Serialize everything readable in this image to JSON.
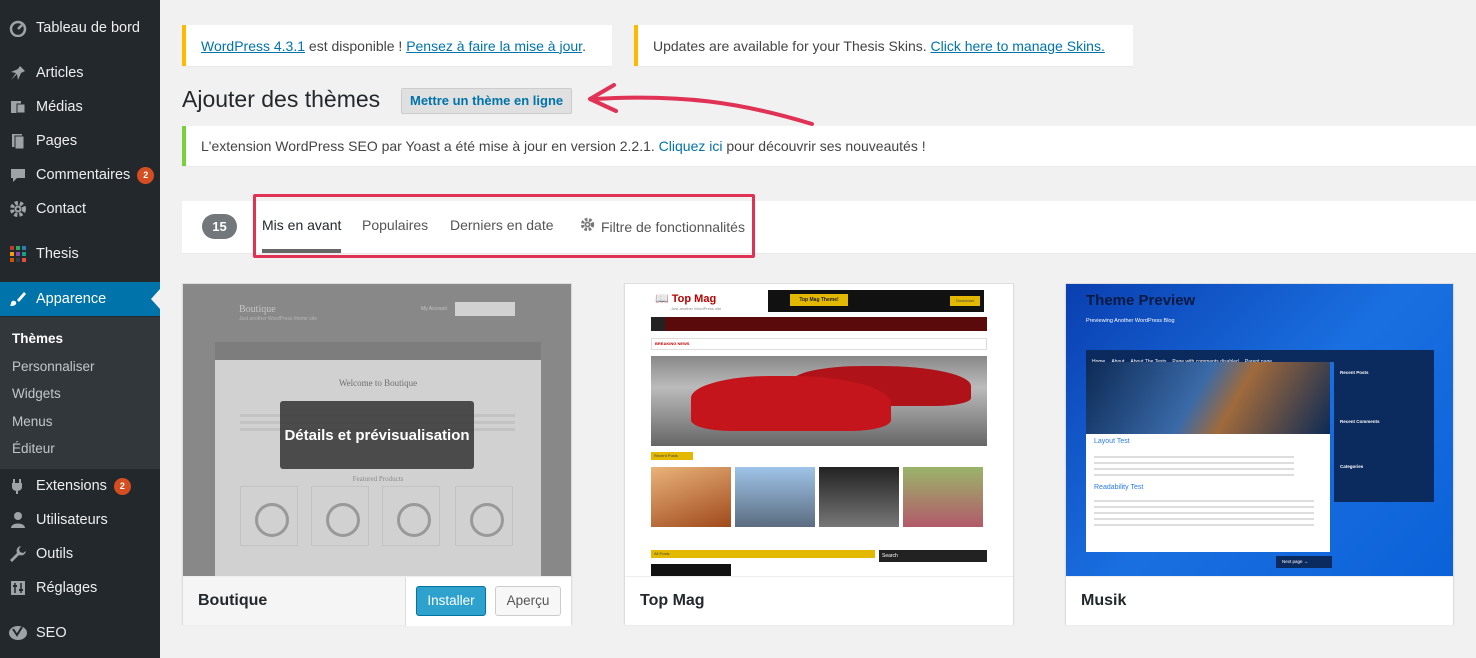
{
  "sidebar": {
    "items": [
      {
        "label": "Tableau de bord",
        "icon": "dashboard-icon"
      },
      {
        "label": "Articles",
        "icon": "pin-icon"
      },
      {
        "label": "Médias",
        "icon": "media-icon"
      },
      {
        "label": "Pages",
        "icon": "pages-icon"
      },
      {
        "label": "Commentaires",
        "icon": "comments-icon",
        "badge": "2"
      },
      {
        "label": "Contact",
        "icon": "gear-icon"
      },
      {
        "label": "Thesis",
        "icon": "grid-icon"
      },
      {
        "label": "Apparence",
        "icon": "brush-icon"
      },
      {
        "label": "Extensions",
        "icon": "plugin-icon",
        "badge": "2"
      },
      {
        "label": "Utilisateurs",
        "icon": "user-icon"
      },
      {
        "label": "Outils",
        "icon": "wrench-icon"
      },
      {
        "label": "Réglages",
        "icon": "settings-icon"
      },
      {
        "label": "SEO",
        "icon": "yoast-icon"
      }
    ],
    "submenu": [
      "Thèmes",
      "Personnaliser",
      "Widgets",
      "Menus",
      "Éditeur"
    ]
  },
  "notices": {
    "wp_link": "WordPress 4.3.1",
    "wp_text": " est disponible ! ",
    "wp_update_link": "Pensez à faire la mise à jour",
    "wp_end": ".",
    "thesis_text": "Updates are available for your Thesis Skins. ",
    "thesis_link": "Click here to manage Skins.",
    "yoast_text": "L'extension WordPress SEO par Yoast a été mise à jour en version 2.2.1. ",
    "yoast_link": "Cliquez ici",
    "yoast_end": " pour découvrir ses nouveautés !"
  },
  "page": {
    "title": "Ajouter des thèmes",
    "upload_button": "Mettre un thème en ligne"
  },
  "filter": {
    "count": "15",
    "tabs": [
      "Mis en avant",
      "Populaires",
      "Derniers en date",
      "Filtre de fonctionnalités"
    ]
  },
  "themes": [
    {
      "name": "Boutique",
      "details_label": "Détails et prévisualisation",
      "install_label": "Installer",
      "preview_label": "Aperçu",
      "shot": {
        "title": "Boutique",
        "subtitle": "Just another WordPress theme site",
        "account": "My Account",
        "welcome": "Welcome to Boutique",
        "featured": "Featured Products"
      }
    },
    {
      "name": "Top Mag",
      "shot": {
        "logo_top": "Top",
        "logo_mag": " Mag",
        "tagline": "Just another WordPress site",
        "ad_button": "Top Mag Theme!",
        "download": "Download",
        "breaking": "BREAKING NEWS",
        "recent": "Recent Posts",
        "all_posts": "All Posts",
        "search": "Search"
      }
    },
    {
      "name": "Musik",
      "shot": {
        "title": "Theme Preview",
        "subtitle": "Previewing Another WordPress Blog",
        "nav": [
          "Home",
          "About",
          "About The Tests",
          "Page with comments disabled",
          "Parent page"
        ],
        "layout_test": "Layout Test",
        "readability": "Readability Test",
        "side": [
          "Recent Posts",
          "Recent Comments",
          "Categories"
        ],
        "next": "Next page →"
      }
    }
  ],
  "colors": {
    "sidebar_bg": "#23282d",
    "accent": "#0073aa",
    "highlight": "#e03255",
    "notice_warning": "#ffba00",
    "notice_success": "#7ad03a",
    "badge": "#d54e21"
  }
}
